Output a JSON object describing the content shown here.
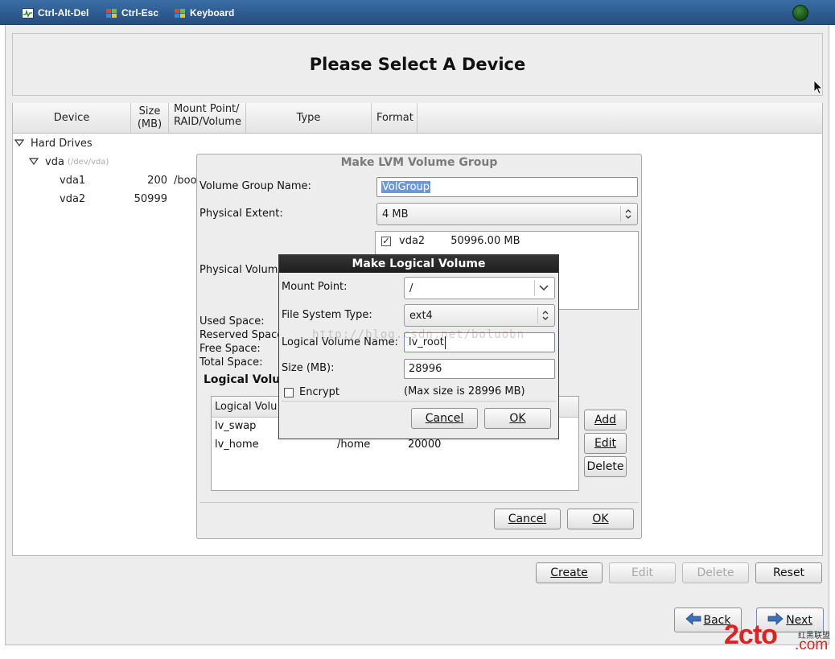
{
  "vnc_toolbar": {
    "ctrl_alt_del": "Ctrl-Alt-Del",
    "ctrl_esc": "Ctrl-Esc",
    "keyboard": "Keyboard"
  },
  "page_title": "Please Select A Device",
  "table": {
    "columns": [
      "Device",
      "Size\n(MB)",
      "Mount Point/\nRAID/Volume",
      "Type",
      "Format"
    ],
    "col_device": "Device",
    "col_size_1": "Size",
    "col_size_2": "(MB)",
    "col_mount_1": "Mount Point/",
    "col_mount_2": "RAID/Volume",
    "col_type": "Type",
    "col_format": "Format",
    "group": "Hard Drives",
    "disk": "vda",
    "disk_path": "(/dev/vda)",
    "rows": [
      {
        "device": "vda1",
        "size": "200",
        "mount": "/boo"
      },
      {
        "device": "vda2",
        "size": "50999",
        "mount": ""
      }
    ]
  },
  "lvm_dialog": {
    "title": "Make LVM Volume Group",
    "vg_name_label": "Volume Group Name:",
    "vg_name_value": "VolGroup",
    "extent_label": "Physical Extent:",
    "extent_value": "4 MB",
    "pv_label": "Physical Volum",
    "pv_item_name": "vda2",
    "pv_item_size": "50996.00 MB",
    "used_space": "Used Space:",
    "reserved_space": "Reserved Space",
    "free_space": "Free Space:",
    "total_space": "Total Space:",
    "lv_section": "Logical Volu",
    "lv_col": "Logical Volu",
    "lv_rows": [
      {
        "name": "lv_swap",
        "mount": "",
        "size": ""
      },
      {
        "name": "lv_home",
        "mount": "/home",
        "size": "20000"
      }
    ],
    "add": "Add",
    "edit": "Edit",
    "delete": "Delete",
    "cancel": "Cancel",
    "ok": "OK"
  },
  "lv_dialog": {
    "title": "Make Logical Volume",
    "mount_label": "Mount Point:",
    "mount_value": "/",
    "fs_label": "File System Type:",
    "fs_value": "ext4",
    "lvname_label": "Logical Volume Name:",
    "lvname_value": "lv_root",
    "size_label": "Size (MB):",
    "size_value": "28996",
    "encrypt_label": "Encrypt",
    "max_size": "(Max size is 28996 MB)",
    "cancel": "Cancel",
    "ok": "OK"
  },
  "bottom": {
    "create": "Create",
    "edit": "Edit",
    "delete": "Delete",
    "reset": "Reset",
    "back": "Back",
    "next": "Next"
  },
  "watermark": "http://blog.csdn.net/boluobn",
  "brand": {
    "logo": "2cto",
    "com": ".com",
    "cn": "红黑联盟"
  }
}
